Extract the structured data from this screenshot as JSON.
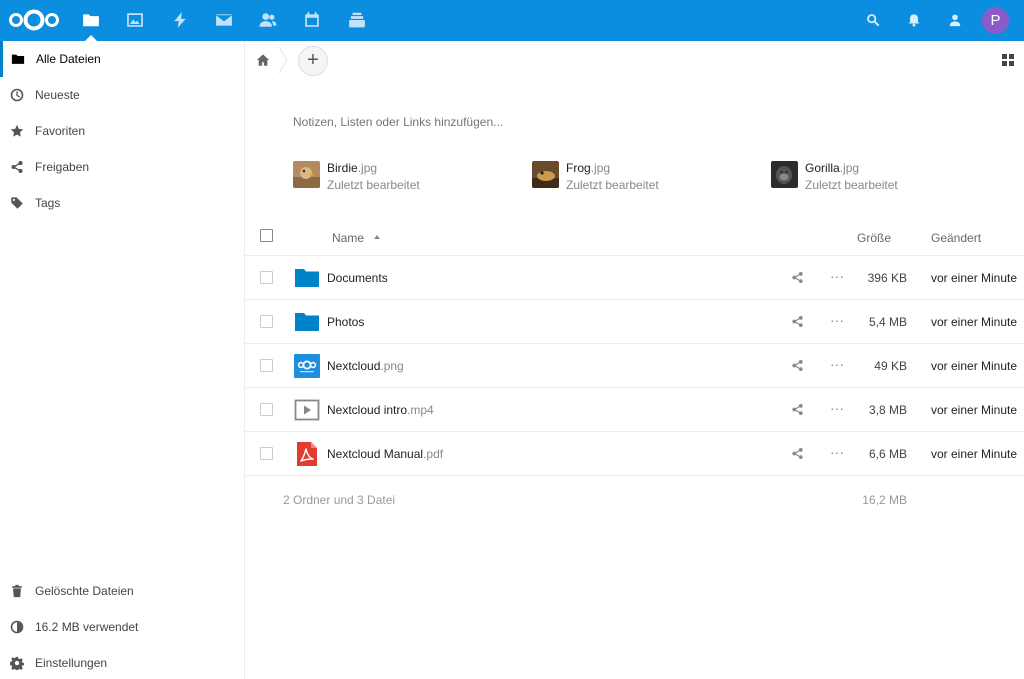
{
  "header": {
    "apps": [
      {
        "name": "files-icon"
      },
      {
        "name": "photos-icon"
      },
      {
        "name": "activity-icon"
      },
      {
        "name": "mail-icon"
      },
      {
        "name": "contacts-icon"
      },
      {
        "name": "calendar-icon"
      },
      {
        "name": "deck-icon"
      }
    ],
    "avatar_letter": "P",
    "avatar_color": "#8a5cc8",
    "bar_color": "#0b8ee0"
  },
  "sidebar": {
    "items": [
      {
        "label": "Alle Dateien",
        "icon": "folder-icon"
      },
      {
        "label": "Neueste",
        "icon": "clock-icon"
      },
      {
        "label": "Favoriten",
        "icon": "star-icon"
      },
      {
        "label": "Freigaben",
        "icon": "share-icon"
      },
      {
        "label": "Tags",
        "icon": "tag-icon"
      }
    ],
    "bottom": [
      {
        "label": "Gelöschte Dateien",
        "icon": "trash-icon"
      },
      {
        "label": "16.2 MB verwendet",
        "icon": "quota-icon"
      },
      {
        "label": "Einstellungen",
        "icon": "gear-icon"
      }
    ]
  },
  "main": {
    "add_label": "+",
    "notes_placeholder": "Notizen, Listen oder Links hinzufügen...",
    "recent": [
      {
        "base": "Birdie",
        "ext": ".jpg",
        "sub": "Zuletzt bearbeitet"
      },
      {
        "base": "Frog",
        "ext": ".jpg",
        "sub": "Zuletzt bearbeitet"
      },
      {
        "base": "Gorilla",
        "ext": ".jpg",
        "sub": "Zuletzt bearbeitet"
      }
    ],
    "columns": {
      "name": "Name",
      "size": "Größe",
      "modified": "Geändert"
    },
    "files": [
      {
        "base": "Documents",
        "ext": "",
        "size": "396 KB",
        "modified": "vor einer Minute",
        "type": "folder"
      },
      {
        "base": "Photos",
        "ext": "",
        "size": "5,4 MB",
        "modified": "vor einer Minute",
        "type": "folder"
      },
      {
        "base": "Nextcloud",
        "ext": ".png",
        "size": "49 KB",
        "modified": "vor einer Minute",
        "type": "image"
      },
      {
        "base": "Nextcloud intro",
        "ext": ".mp4",
        "size": "3,8 MB",
        "modified": "vor einer Minute",
        "type": "video"
      },
      {
        "base": "Nextcloud Manual",
        "ext": ".pdf",
        "size": "6,6 MB",
        "modified": "vor einer Minute",
        "type": "pdf"
      }
    ],
    "more_label": "···",
    "summary": {
      "count": "2 Ordner und 3 Datei",
      "size": "16,2 MB"
    }
  }
}
